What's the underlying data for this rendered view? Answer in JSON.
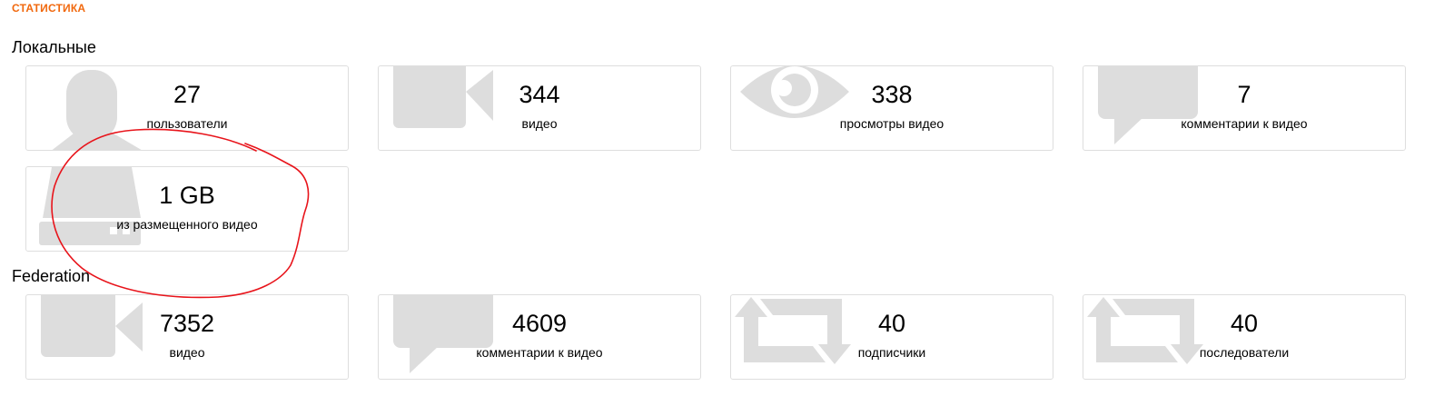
{
  "header": {
    "title": "СТАТИСТИКА",
    "accent_color": "#f1680d"
  },
  "sections": {
    "local": {
      "title": "Локальные",
      "cards": [
        {
          "value": "27",
          "label": "пользователи",
          "icon": "user-icon"
        },
        {
          "value": "344",
          "label": "видео",
          "icon": "video-camera-icon"
        },
        {
          "value": "338",
          "label": "просмотры видео",
          "icon": "eye-icon"
        },
        {
          "value": "7",
          "label": "комментарии к видео",
          "icon": "comment-icon"
        },
        {
          "value": "1 GB",
          "label": "из размещенного видео",
          "icon": "hard-drive-icon"
        }
      ]
    },
    "federation": {
      "title": "Federation",
      "cards": [
        {
          "value": "7352",
          "label": "видео",
          "icon": "video-camera-icon"
        },
        {
          "value": "4609",
          "label": "комментарии к видео",
          "icon": "comment-icon"
        },
        {
          "value": "40",
          "label": "подписчики",
          "icon": "repeat-icon"
        },
        {
          "value": "40",
          "label": "последователи",
          "icon": "repeat-icon"
        }
      ]
    }
  },
  "colors": {
    "icon_fill": "#dddddd",
    "card_border": "#dedede",
    "annotation_stroke": "#e8141b"
  }
}
